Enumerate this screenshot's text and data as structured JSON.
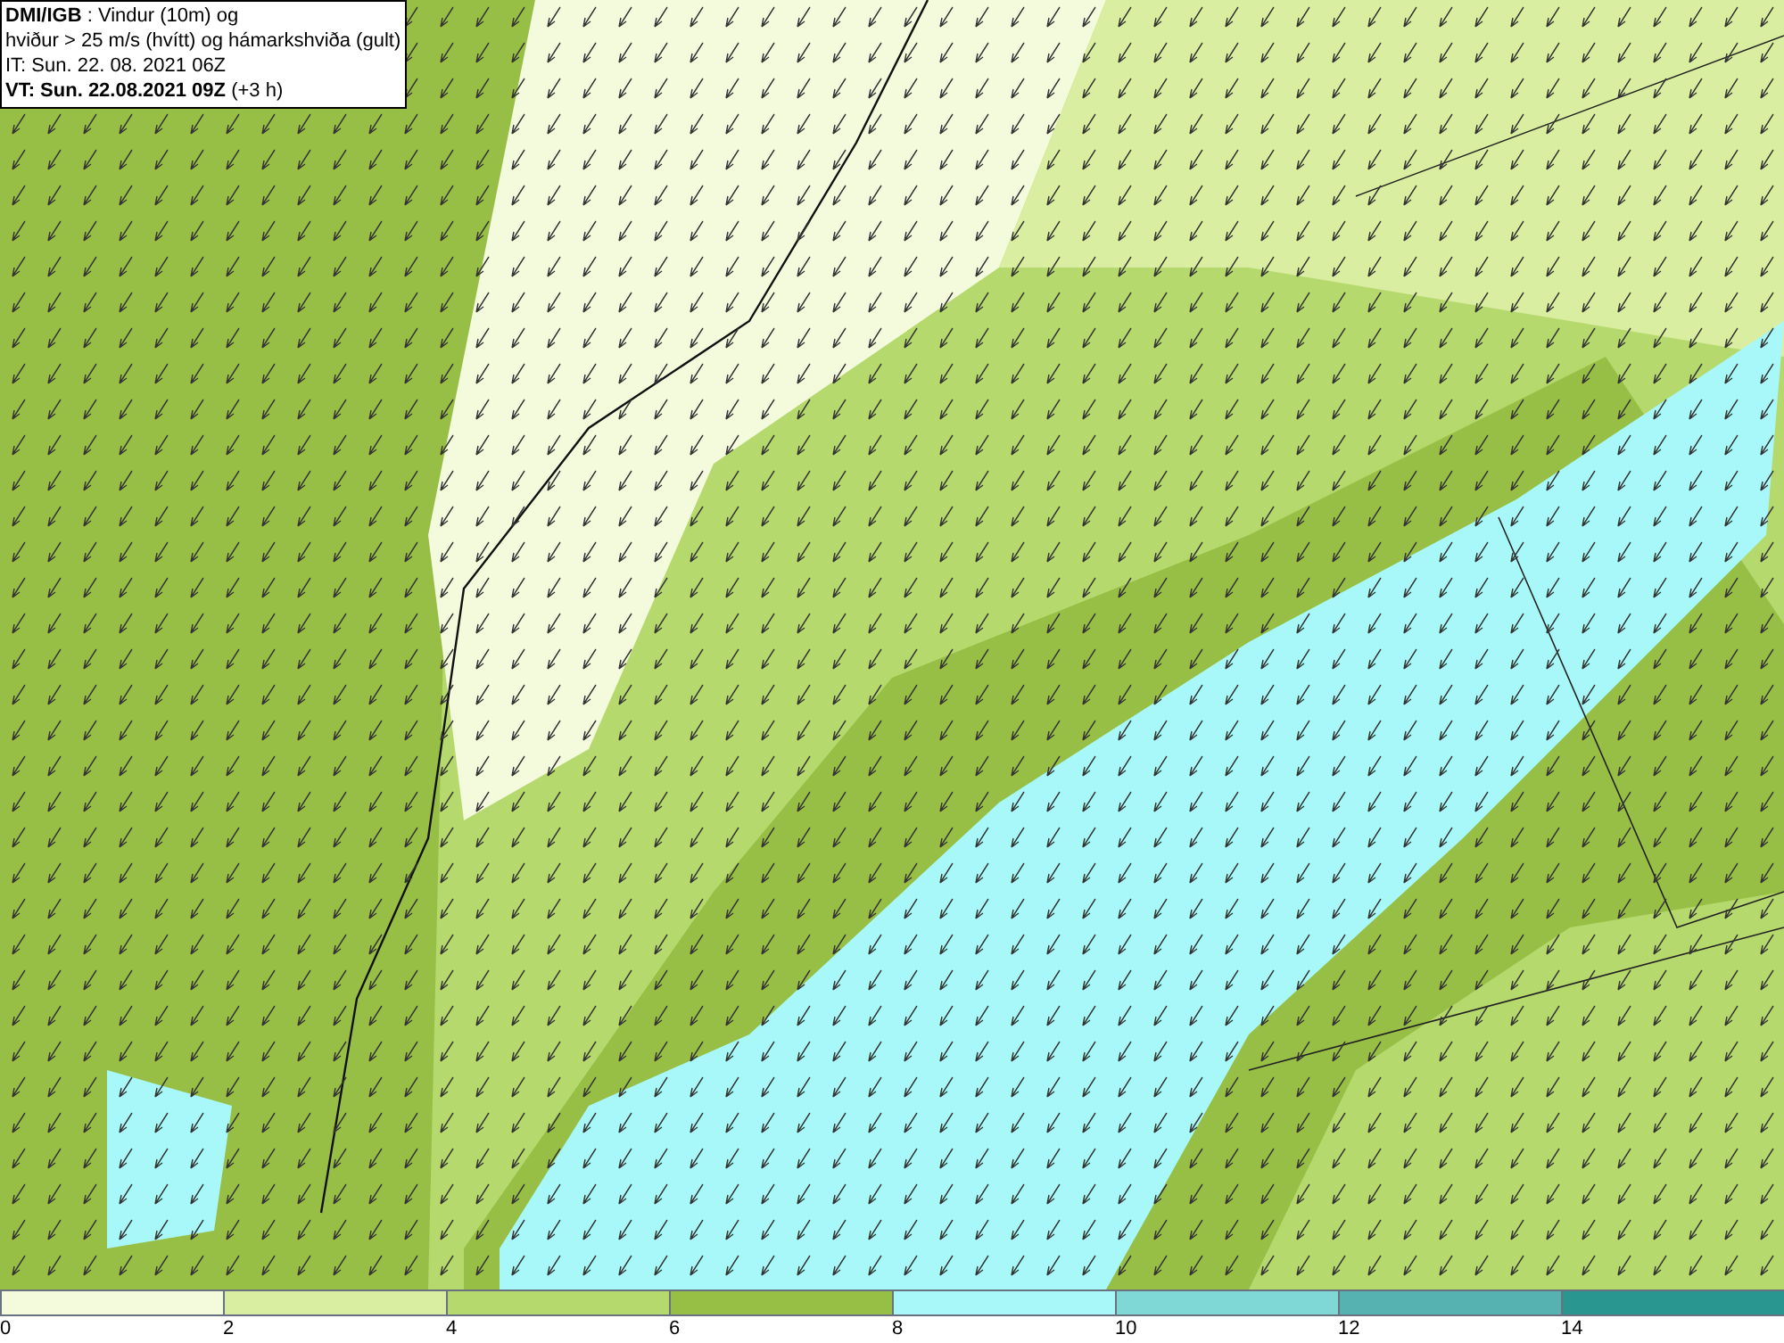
{
  "title_box": {
    "lines": [
      "**DMI/IGB** : Vindur (10m) og",
      "hviður > 25 m/s (hvítt) og hámarkshviða (gult)",
      "IT: Sun. 22. 08. 2021 06Z",
      "**VT: Sun. 22.08.2021 09Z** (+3 h)"
    ]
  },
  "legend": [
    {
      "label": "0",
      "color": "#f4fadc"
    },
    {
      "label": "2",
      "color": "#d9eea0"
    },
    {
      "label": "4",
      "color": "#b6d96e"
    },
    {
      "label": "6",
      "color": "#98bf45"
    },
    {
      "label": "8",
      "color": "#a8f8fa"
    },
    {
      "label": "10",
      "color": "#7fd8d6"
    },
    {
      "label": "12",
      "color": "#55b2b0"
    },
    {
      "label": "14",
      "color": "#2a9690"
    }
  ]
}
